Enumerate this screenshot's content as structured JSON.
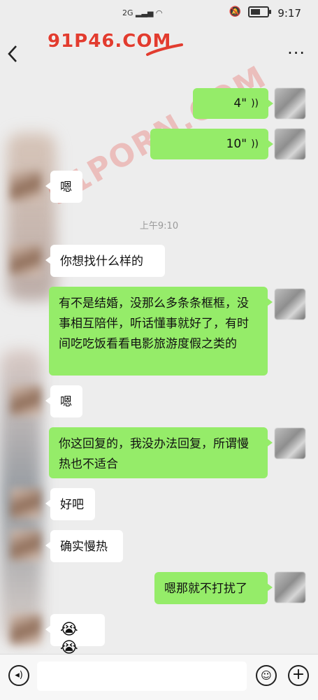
{
  "status_bar": {
    "network": "2G",
    "time": "9:17",
    "battery_level": 0.6
  },
  "watermarks": {
    "top": "91P46.COM",
    "middle": "91PORN.COM"
  },
  "messages": [
    {
      "side": "right",
      "type": "voice",
      "text": "4\""
    },
    {
      "side": "right",
      "type": "voice",
      "text": "10\""
    },
    {
      "side": "left",
      "type": "text",
      "text": "嗯"
    },
    {
      "side": "left",
      "type": "text",
      "text": "你想找什么样的"
    },
    {
      "side": "right",
      "type": "text",
      "text": "有不是结婚，没那么多条条框框，没事相互陪伴，听话懂事就好了，有时间吃吃饭看看电影旅游度假之类的"
    },
    {
      "side": "left",
      "type": "text",
      "text": "嗯"
    },
    {
      "side": "right",
      "type": "text",
      "text": "你这回复的，我没办法回复，所谓慢热也不适合"
    },
    {
      "side": "left",
      "type": "text",
      "text": "好吧"
    },
    {
      "side": "left",
      "type": "text",
      "text": "确实慢热"
    },
    {
      "side": "right",
      "type": "text",
      "text": "嗯那就不打扰了"
    },
    {
      "side": "left",
      "type": "emoji",
      "text": "😭😭"
    }
  ],
  "timestamp": "上午9:10",
  "icons": {
    "back": "chevron-left-icon",
    "more": "more-dots-icon",
    "voice_input": "voice-mode-icon",
    "emoji": "emoji-icon",
    "plus": "plus-icon",
    "voice_wave": "voice-wave-icon"
  },
  "colors": {
    "green_bubble": "#95ec69",
    "white_bubble": "#ffffff",
    "background": "#ededed",
    "watermark": "#e23c2f"
  }
}
